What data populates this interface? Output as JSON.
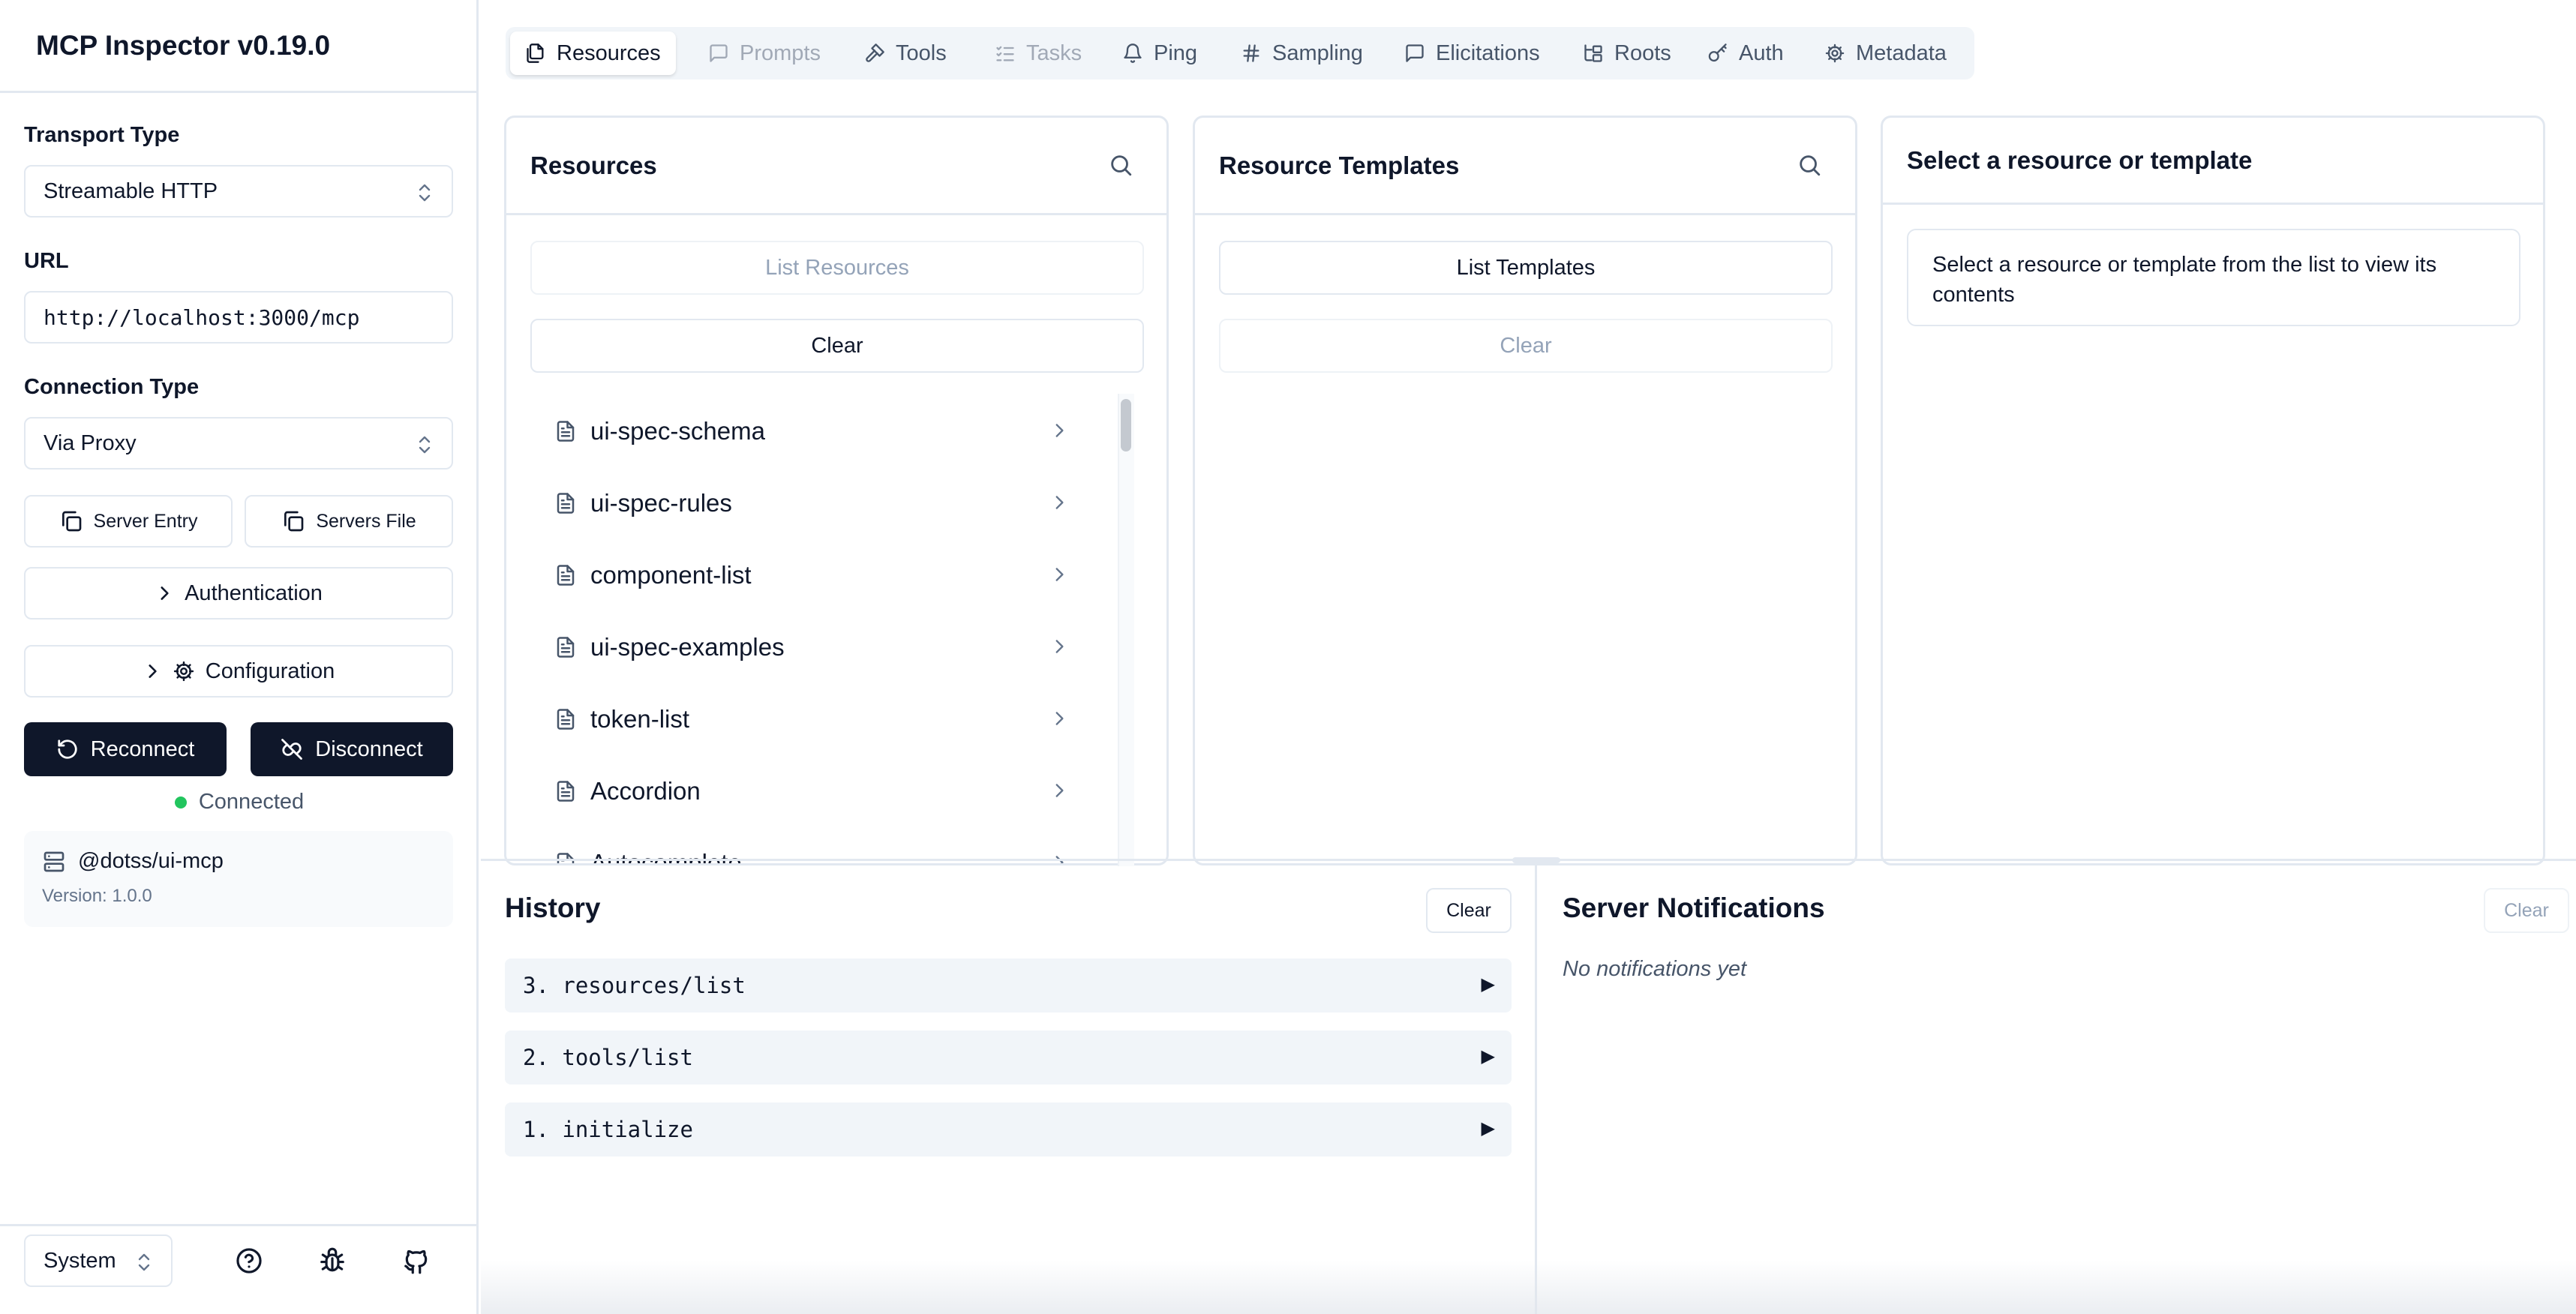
{
  "app": {
    "title": "MCP Inspector v0.19.0"
  },
  "sidebar": {
    "transport_label": "Transport Type",
    "transport_value": "Streamable HTTP",
    "url_label": "URL",
    "url_value": "http://localhost:3000/mcp",
    "connection_label": "Connection Type",
    "connection_value": "Via Proxy",
    "server_entry": "Server Entry",
    "servers_file": "Servers File",
    "authentication": "Authentication",
    "configuration": "Configuration",
    "reconnect": "Reconnect",
    "disconnect": "Disconnect",
    "status": "Connected",
    "server_name": "@dotss/ui-mcp",
    "server_version": "Version: 1.0.0",
    "theme": "System",
    "footer_icons": [
      "help-icon",
      "bug-icon",
      "github-icon"
    ]
  },
  "tabs": [
    {
      "label": "Resources",
      "icon": "files-icon",
      "state": "active"
    },
    {
      "label": "Prompts",
      "icon": "message-icon",
      "state": "disabled"
    },
    {
      "label": "Tools",
      "icon": "hammer-icon",
      "state": "normal"
    },
    {
      "label": "Tasks",
      "icon": "list-checks-icon",
      "state": "disabled"
    },
    {
      "label": "Ping",
      "icon": "bell-icon",
      "state": "normal"
    },
    {
      "label": "Sampling",
      "icon": "hash-icon",
      "state": "normal"
    },
    {
      "label": "Elicitations",
      "icon": "message-icon",
      "state": "normal"
    },
    {
      "label": "Roots",
      "icon": "folder-tree-icon",
      "state": "normal"
    },
    {
      "label": "Auth",
      "icon": "key-icon",
      "state": "normal"
    },
    {
      "label": "Metadata",
      "icon": "gear-icon",
      "state": "normal"
    }
  ],
  "resources_panel": {
    "title": "Resources",
    "list_button": "List Resources",
    "clear_button": "Clear",
    "items": [
      "ui-spec-schema",
      "ui-spec-rules",
      "component-list",
      "ui-spec-examples",
      "token-list",
      "Accordion",
      "Autocomplete"
    ]
  },
  "templates_panel": {
    "title": "Resource Templates",
    "list_button": "List Templates",
    "clear_button": "Clear"
  },
  "detail_panel": {
    "title": "Select a resource or template",
    "message": "Select a resource or template from the list to view its contents"
  },
  "history": {
    "title": "History",
    "clear_button": "Clear",
    "items": [
      "3. resources/list",
      "2. tools/list",
      "1. initialize"
    ],
    "expand_glyph": "▶"
  },
  "notifications": {
    "title": "Server Notifications",
    "clear_button": "Clear",
    "empty_text": "No notifications yet"
  },
  "colors": {
    "primary_dark": "#0f172a",
    "border": "#e2e8f0",
    "status_green": "#22c55e",
    "muted_bg": "#f1f5f9"
  }
}
